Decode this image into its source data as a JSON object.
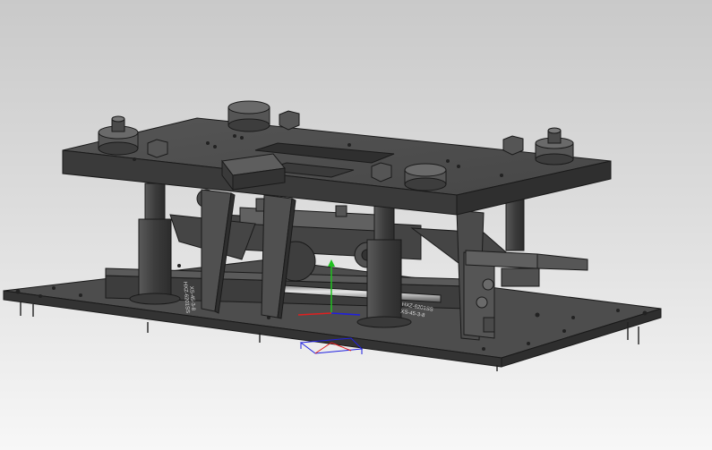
{
  "viewport": {
    "background_top": "#c9c9c9",
    "background_bottom": "#f7f7f7",
    "model_color": "#4a4a4a",
    "edge_color": "#1a1a1a",
    "highlight_color": "#cfcfcf"
  },
  "model": {
    "name": "punch-press-die-set",
    "engraved_labels": {
      "front_left": "HXZ-6201SS",
      "front_left_line2": "XS-45-3-8",
      "front_right": "HXZ-6201SS",
      "front_right_line2": "XS-45-3-8"
    }
  },
  "triad": {
    "x_axis_color": "#e02020",
    "y_axis_color": "#20c020",
    "z_axis_color": "#2020e0"
  }
}
